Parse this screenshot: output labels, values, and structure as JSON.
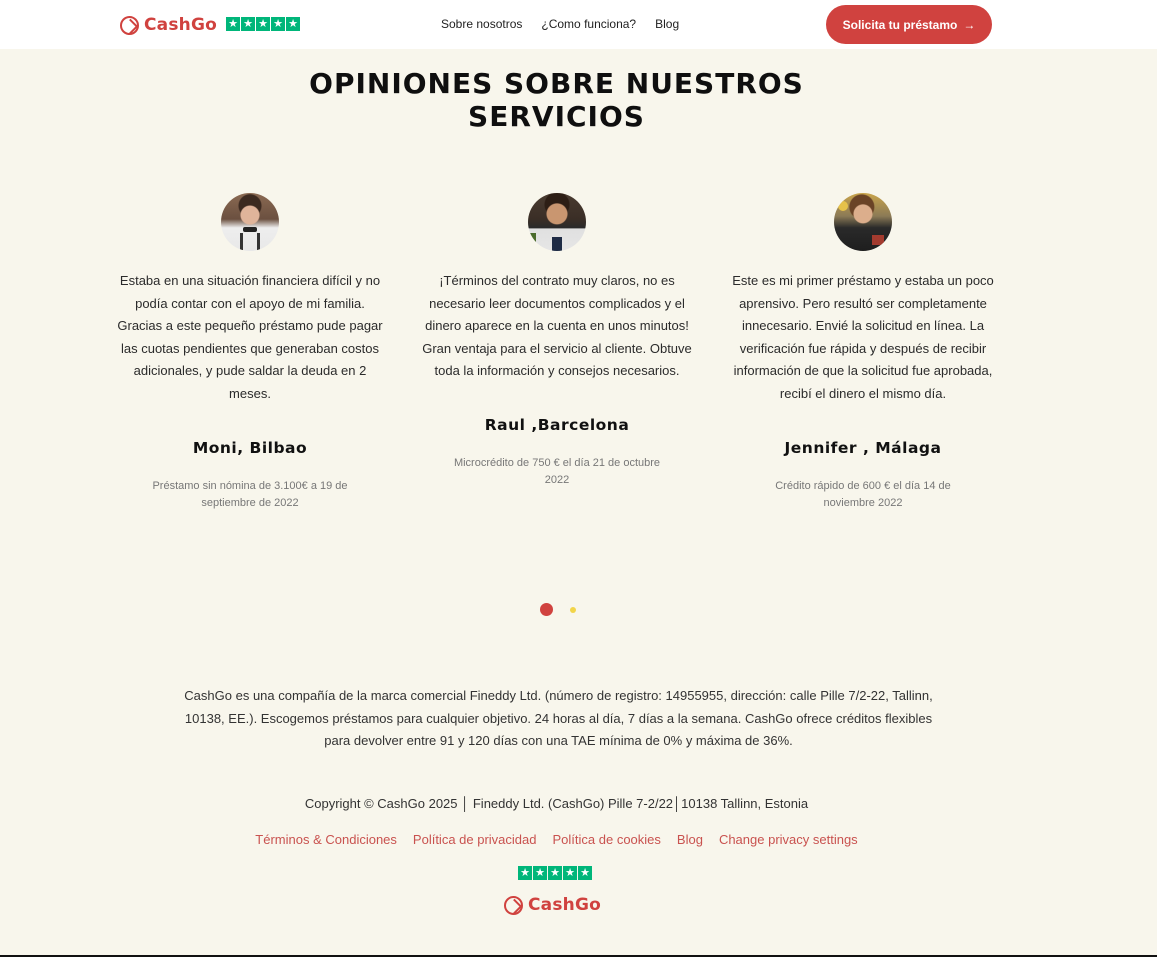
{
  "header": {
    "brand": "CashGo",
    "nav": [
      {
        "label": "Sobre nosotros"
      },
      {
        "label": "¿Como funciona?"
      },
      {
        "label": "Blog"
      }
    ],
    "cta_label": "Solicita tu préstamo",
    "cta_icon": "arrow-right-icon"
  },
  "section": {
    "title_line1": "OPINIONES SOBRE NUESTROS",
    "title_line2": "SERVICIOS"
  },
  "testimonials": [
    {
      "text": "Estaba en una situación financiera difícil y no podía contar con el apoyo de mi familia. Gracias a este pequeño préstamo pude pagar las cuotas pendientes que generaban costos adicionales, y pude saldar la deuda en 2 meses.",
      "name": "Moni, Bilbao",
      "meta": "Préstamo sin nómina de 3.100€ a 19 de septiembre de 2022"
    },
    {
      "text": "¡Términos del contrato muy claros, no es necesario leer documentos complicados y el dinero aparece en la cuenta en unos minutos! Gran ventaja para el servicio al cliente. Obtuve toda la información y consejos necesarios.",
      "name": "Raul ,Barcelona",
      "meta": "Microcrédito de 750 € el día 21 de octubre 2022"
    },
    {
      "text": "Este es mi primer préstamo y estaba un poco aprensivo. Pero resultó ser completamente innecesario. Envié la solicitud en línea. La verificación fue rápida y después de recibir información de que la solicitud fue aprobada, recibí el dinero el mismo día.",
      "name": "Jennifer , Málaga",
      "meta": "Crédito rápido de 600 € el día 14 de noviembre 2022"
    }
  ],
  "footer": {
    "about": "CashGo es una compañía de la marca comercial Fineddy Ltd. (número de registro: 14955955, dirección: calle Pille 7/2-22, Tallinn, 10138, EE.). Escogemos préstamos para cualquier objetivo. 24 horas al día, 7 días a la semana. CashGo ofrece créditos flexibles para devolver entre 91 y 120 días con una TAE mínima de 0% y máxima de 36%.",
    "copyright": "Copyright © CashGo 2025 │ Fineddy Ltd. (CashGo) Pille 7-2/22│10138 Tallinn, Estonia",
    "links": [
      {
        "label": "Términos & Condiciones"
      },
      {
        "label": "Política de privacidad"
      },
      {
        "label": "Política de cookies"
      },
      {
        "label": "Blog"
      },
      {
        "label": "Change privacy settings"
      }
    ],
    "brand": "CashGo"
  },
  "colors": {
    "brand": "#d0423f",
    "background": "#f8f6ec",
    "trustpilot": "#00b67a",
    "dot_inactive": "#f2d54a"
  }
}
